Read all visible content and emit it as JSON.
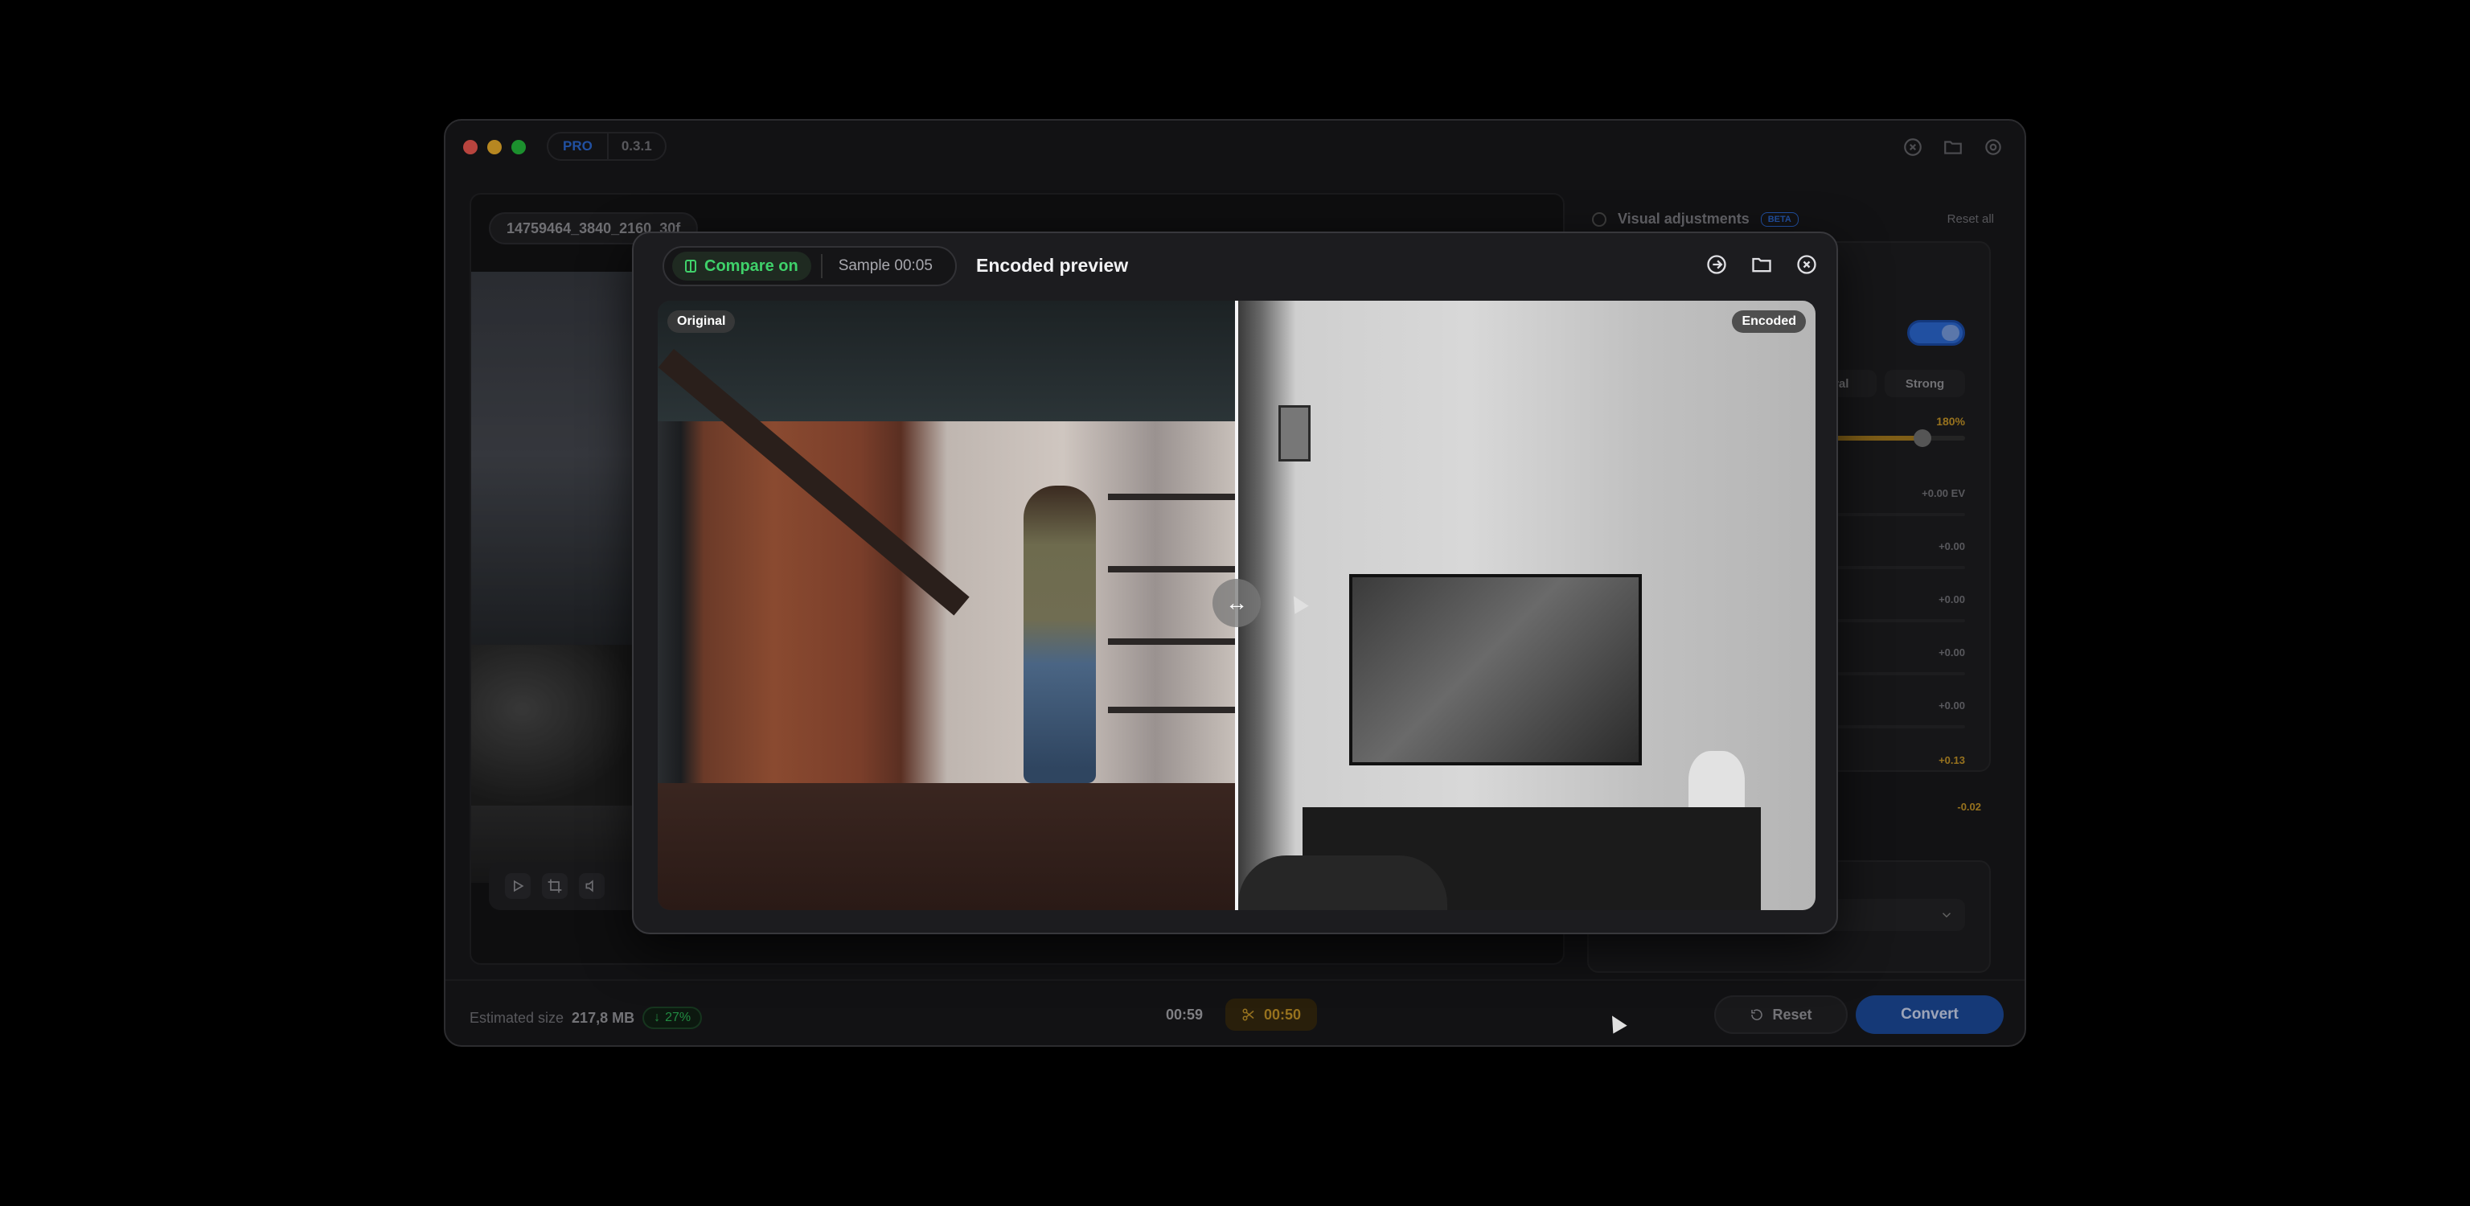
{
  "app": {
    "edition": "PRO",
    "version": "0.3.1",
    "traffic_colors": [
      "#ff5f57",
      "#febc2e",
      "#28c840"
    ]
  },
  "viewer": {
    "file_name": "14759464_3840_2160_30f"
  },
  "adjustments": {
    "title": "Visual adjustments",
    "badge": "BETA",
    "reset_all": "Reset all",
    "presets": [
      "atural",
      "Strong"
    ],
    "strength": "180%",
    "rows": [
      "+0.00 EV",
      "+0.00",
      "+0.00",
      "+0.00",
      "+0.00",
      "+0.13",
      "-0.02"
    ]
  },
  "footer": {
    "estimated_label": "Estimated size",
    "estimated_value": "217,8 MB",
    "savings": "27%",
    "duration": "00:59",
    "trim_duration": "00:50",
    "reset_label": "Reset",
    "convert_label": "Convert"
  },
  "preview": {
    "compare_label": "Compare on",
    "sample_label": "Sample 00:05",
    "title": "Encoded preview",
    "original_label": "Original",
    "encoded_label": "Encoded",
    "split_fraction": 0.5
  },
  "colors": {
    "accent_blue": "#2f6fe0",
    "accent_green": "#3fd16a",
    "accent_amber": "#d19e2a"
  }
}
